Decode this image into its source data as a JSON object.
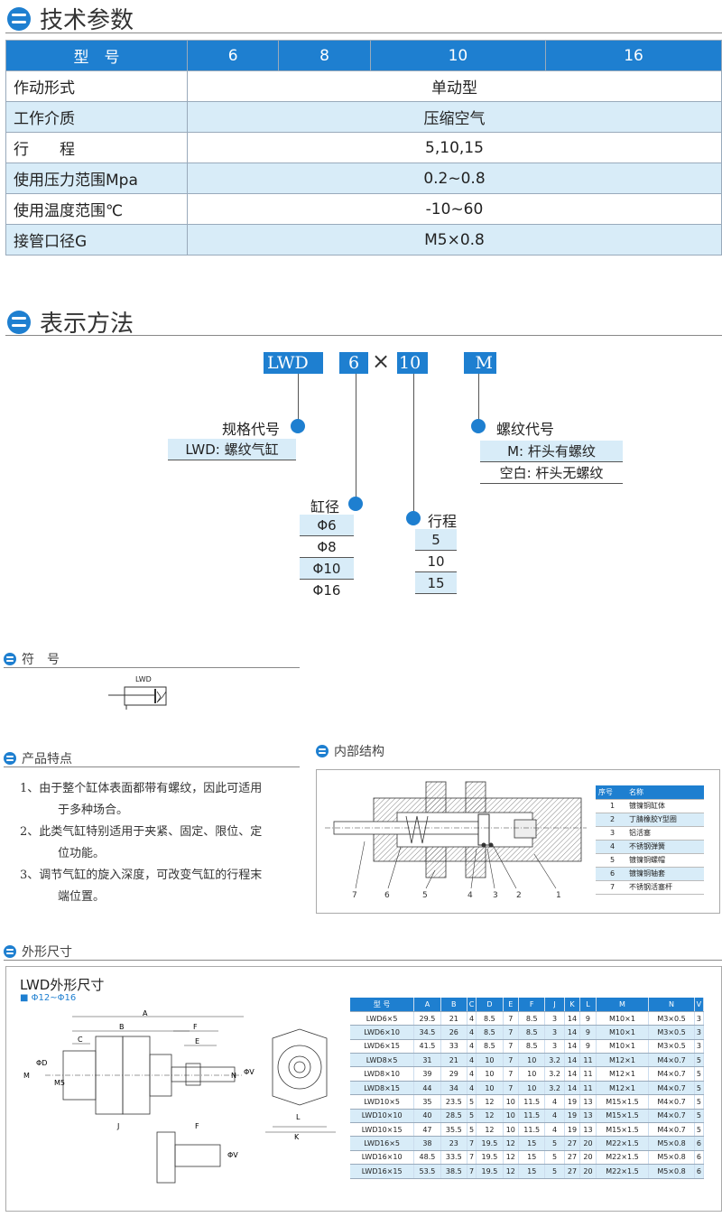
{
  "sections": {
    "tech": "技术参数",
    "notation": "表示方法",
    "symbol": "符　号",
    "features": "产品特点",
    "internal": "内部结构",
    "outline": "外形尺寸"
  },
  "spec": {
    "header": [
      "型　号",
      "6",
      "8",
      "10",
      "16"
    ],
    "rows": [
      {
        "label": "作动形式",
        "value": "单动型"
      },
      {
        "label": "工作介质",
        "value": "压缩空气"
      },
      {
        "label": "行　　程",
        "value": "5,10,15"
      },
      {
        "label": "使用压力范围Mpa",
        "value": "0.2~0.8"
      },
      {
        "label": "使用温度范围℃",
        "value": "-10~60"
      },
      {
        "label": "接管口径G",
        "value": "M5×0.8"
      }
    ]
  },
  "notation": {
    "codes": [
      "LWD",
      "6",
      "×",
      "10",
      "M"
    ],
    "spec_code": {
      "title": "规格代号",
      "value": "LWD: 螺纹气缸"
    },
    "thread_code": {
      "title": "螺纹代号",
      "items": [
        "M: 杆头有螺纹",
        "空白: 杆头无螺纹"
      ]
    },
    "bore": {
      "title": "缸径",
      "items": [
        "Φ6",
        "Φ8",
        "Φ10",
        "Φ16"
      ]
    },
    "stroke": {
      "title": "行程",
      "items": [
        "5",
        "10",
        "15"
      ]
    }
  },
  "symbol": {
    "label": "LWD"
  },
  "features": [
    "1、由于整个缸体表面都带有螺纹，因此可适用",
    "于多种场合。",
    "2、此类气缸特别适用于夹紧、固定、限位、定",
    "位功能。",
    "3、调节气缸的旋入深度，可改变气缸的行程末",
    "端位置。"
  ],
  "parts": {
    "header": [
      "序号",
      "名称"
    ],
    "rows": [
      [
        "1",
        "镀镍铜缸体"
      ],
      [
        "2",
        "丁腈橡胶Y型圈"
      ],
      [
        "3",
        "铝活塞"
      ],
      [
        "4",
        "不锈钢弹簧"
      ],
      [
        "5",
        "镀镍铜螺帽"
      ],
      [
        "6",
        "镀镍铜轴套"
      ],
      [
        "7",
        "不锈钢活塞杆"
      ]
    ],
    "callouts": [
      "7",
      "6",
      "5",
      "4",
      "3",
      "2",
      "1"
    ]
  },
  "outline": {
    "title": "LWD外形尺寸",
    "subtitle": "■ Φ12~Φ16",
    "dims": [
      "A",
      "B",
      "C",
      "E",
      "F",
      "M",
      "M5",
      "ΦD",
      "N",
      "J",
      "ΦV",
      "F",
      "ΦV",
      "L",
      "K"
    ]
  },
  "dims": {
    "header": [
      "型 号",
      "A",
      "B",
      "C",
      "D",
      "E",
      "F",
      "J",
      "K",
      "L",
      "M",
      "N",
      "V"
    ],
    "rows": [
      [
        "LWD6×5",
        "29.5",
        "21",
        "4",
        "8.5",
        "7",
        "8.5",
        "3",
        "14",
        "9",
        "M10×1",
        "M3×0.5",
        "3"
      ],
      [
        "LWD6×10",
        "34.5",
        "26",
        "4",
        "8.5",
        "7",
        "8.5",
        "3",
        "14",
        "9",
        "M10×1",
        "M3×0.5",
        "3"
      ],
      [
        "LWD6×15",
        "41.5",
        "33",
        "4",
        "8.5",
        "7",
        "8.5",
        "3",
        "14",
        "9",
        "M10×1",
        "M3×0.5",
        "3"
      ],
      [
        "LWD8×5",
        "31",
        "21",
        "4",
        "10",
        "7",
        "10",
        "3.2",
        "14",
        "11",
        "M12×1",
        "M4×0.7",
        "5"
      ],
      [
        "LWD8×10",
        "39",
        "29",
        "4",
        "10",
        "7",
        "10",
        "3.2",
        "14",
        "11",
        "M12×1",
        "M4×0.7",
        "5"
      ],
      [
        "LWD8×15",
        "44",
        "34",
        "4",
        "10",
        "7",
        "10",
        "3.2",
        "14",
        "11",
        "M12×1",
        "M4×0.7",
        "5"
      ],
      [
        "LWD10×5",
        "35",
        "23.5",
        "5",
        "12",
        "10",
        "11.5",
        "4",
        "19",
        "13",
        "M15×1.5",
        "M4×0.7",
        "5"
      ],
      [
        "LWD10×10",
        "40",
        "28.5",
        "5",
        "12",
        "10",
        "11.5",
        "4",
        "19",
        "13",
        "M15×1.5",
        "M4×0.7",
        "5"
      ],
      [
        "LWD10×15",
        "47",
        "35.5",
        "5",
        "12",
        "10",
        "11.5",
        "4",
        "19",
        "13",
        "M15×1.5",
        "M4×0.7",
        "5"
      ],
      [
        "LWD16×5",
        "38",
        "23",
        "7",
        "19.5",
        "12",
        "15",
        "5",
        "27",
        "20",
        "M22×1.5",
        "M5×0.8",
        "6"
      ],
      [
        "LWD16×10",
        "48.5",
        "33.5",
        "7",
        "19.5",
        "12",
        "15",
        "5",
        "27",
        "20",
        "M22×1.5",
        "M5×0.8",
        "6"
      ],
      [
        "LWD16×15",
        "53.5",
        "38.5",
        "7",
        "19.5",
        "12",
        "15",
        "5",
        "27",
        "20",
        "M22×1.5",
        "M5×0.8",
        "6"
      ]
    ]
  }
}
